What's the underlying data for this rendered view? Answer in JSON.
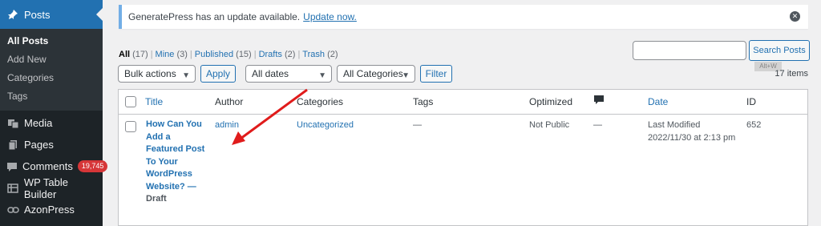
{
  "sidebar": {
    "posts": "Posts",
    "submenu": [
      "All Posts",
      "Add New",
      "Categories",
      "Tags"
    ],
    "menu": [
      {
        "label": "Media"
      },
      {
        "label": "Pages"
      },
      {
        "label": "Comments",
        "badge": "19,745"
      },
      {
        "label": "WP Table Builder"
      },
      {
        "label": "AzonPress"
      }
    ]
  },
  "notice": {
    "text": "GeneratePress has an update available.",
    "link": "Update now."
  },
  "filters": {
    "views": [
      {
        "label": "All",
        "count": "(17)"
      },
      {
        "label": "Mine",
        "count": "(3)"
      },
      {
        "label": "Published",
        "count": "(15)"
      },
      {
        "label": "Drafts",
        "count": "(2)"
      },
      {
        "label": "Trash",
        "count": "(2)"
      }
    ],
    "bulk_actions": "Bulk actions",
    "apply": "Apply",
    "dates": "All dates",
    "categories": "All Categories",
    "filter": "Filter",
    "search_button": "Search Posts",
    "tooltip": "Alt+W",
    "items_count": "17 items"
  },
  "table": {
    "headers": {
      "title": "Title",
      "author": "Author",
      "categories": "Categories",
      "tags": "Tags",
      "optimized": "Optimized",
      "date": "Date",
      "id": "ID"
    },
    "row": {
      "title_lines": [
        "How Can You",
        "Add a",
        "Featured Post",
        "To Your",
        "WordPress",
        "Website? —"
      ],
      "state": "Draft",
      "author": "admin",
      "category": "Uncategorized",
      "tags": "—",
      "optimized": "Not Public",
      "comments": "—",
      "date_status": "Last Modified",
      "date_value": "2022/11/30 at 2:13 pm",
      "id": "652"
    }
  },
  "colors": {
    "accent": "#2271b1",
    "sidebar": "#1d2327",
    "arrow": "#e01b1b"
  }
}
